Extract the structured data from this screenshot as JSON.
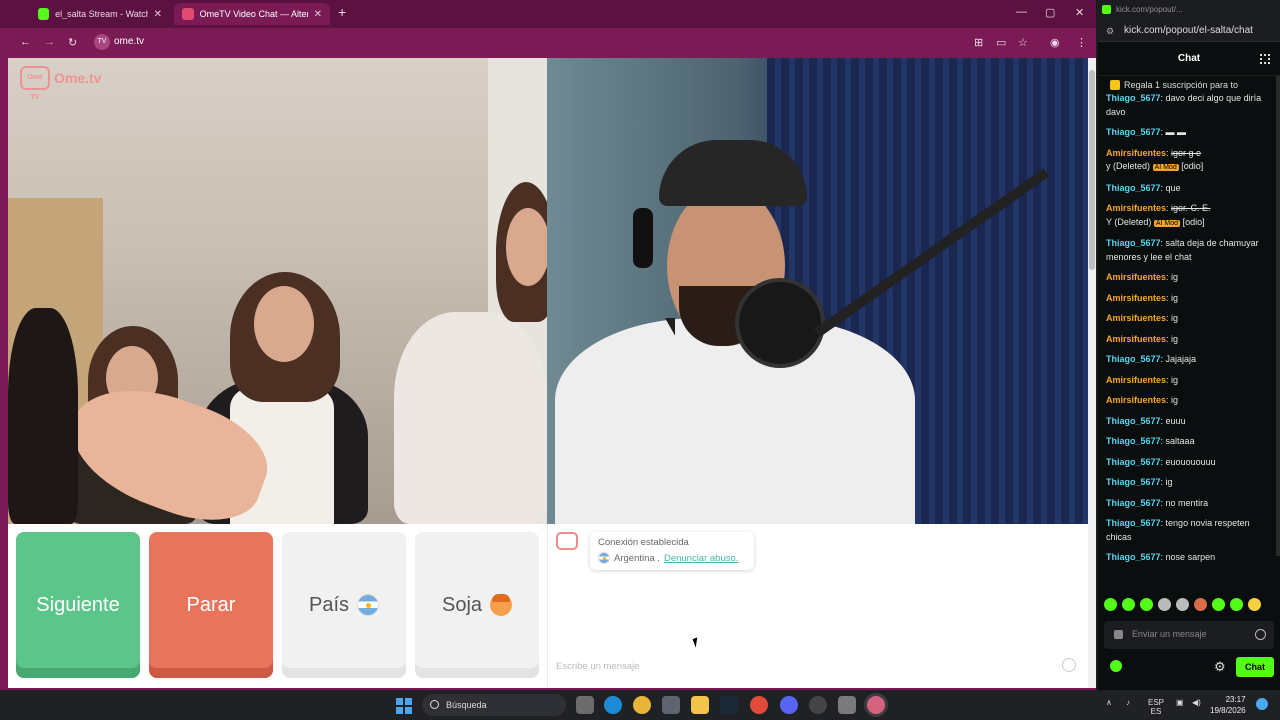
{
  "browser": {
    "tabs": [
      {
        "label": "el_salta Stream - Watch Live on Kick",
        "fav_color": "#53fc18"
      },
      {
        "label": "OmeTV Video Chat — Alternative",
        "fav_color": "#e24b6f"
      }
    ],
    "url": "ome.tv",
    "site_badge": "TV"
  },
  "ometv": {
    "logo_text_a": "Ome",
    "logo_text_b": ".tv",
    "logo_icon_text": "Ome TV",
    "buttons": {
      "next": "Siguiente",
      "stop": "Parar",
      "country": "País",
      "gender": "Soja"
    },
    "system_message": {
      "title": "Conexión establecida",
      "country": "Argentina .",
      "report": "Denunciar abuso."
    },
    "input_placeholder": "Escribe un mensaje"
  },
  "kick": {
    "window_url": "kick.com/popout/...",
    "address": "kick.com/popout/el-salta/chat",
    "header": "Chat",
    "pinned": "Regala 1 suscripción para to",
    "messages": [
      {
        "user": "Thiago_5677",
        "color": "cyan",
        "text": "davo deci algo que diría davo"
      },
      {
        "user": "Thiago_5677",
        "color": "cyan",
        "text": "▬ ▬"
      },
      {
        "user": "Amirsifuentes",
        "color": "orange",
        "text": "igor g e",
        "strike": true,
        "extra": "y (Deleted)",
        "badge": "AI Mod",
        "tail": "[odio]"
      },
      {
        "user": "Thiago_5677",
        "color": "cyan",
        "text": "que"
      },
      {
        "user": "Amirsifuentes",
        "color": "orange",
        "text": "igor. C. E.",
        "strike": true,
        "extra": "Y (Deleted)",
        "badge": "AI Mod",
        "tail": "[odio]"
      },
      {
        "user": "Thiago_5677",
        "color": "cyan",
        "text": "salta deja de chamuyar menores y lee el chat"
      },
      {
        "user": "Amirsifuentes",
        "color": "orange",
        "text": "ig"
      },
      {
        "user": "Amirsifuentes",
        "color": "orange",
        "text": "ig"
      },
      {
        "user": "Amirsifuentes",
        "color": "orange",
        "text": "ig"
      },
      {
        "user": "Amirsifuentes",
        "color": "orange",
        "text": "ig"
      },
      {
        "user": "Thiago_5677",
        "color": "cyan",
        "text": "Jajajaja"
      },
      {
        "user": "Amirsifuentes",
        "color": "orange",
        "text": "ig"
      },
      {
        "user": "Amirsifuentes",
        "color": "orange",
        "text": "ig"
      },
      {
        "user": "Thiago_5677",
        "color": "cyan",
        "text": "euuu"
      },
      {
        "user": "Thiago_5677",
        "color": "cyan",
        "text": "saltaaa"
      },
      {
        "user": "Thiago_5677",
        "color": "cyan",
        "text": "euouououuu"
      },
      {
        "user": "Thiago_5677",
        "color": "cyan",
        "text": "ig"
      },
      {
        "user": "Thiago_5677",
        "color": "cyan",
        "text": "no mentira"
      },
      {
        "user": "Thiago_5677",
        "color": "cyan",
        "text": "tengo novia respeten chicas"
      },
      {
        "user": "Thiago_5677",
        "color": "cyan",
        "text": "nose sarpen"
      }
    ],
    "input_placeholder": "Enviar un mensaje",
    "chat_button": "Chat"
  },
  "taskbar": {
    "search_label": "Búsqueda",
    "lang": "ESP",
    "lang_sub": "ES",
    "time": "23:17",
    "date": "19/8/2026"
  },
  "colors": {
    "browser_frame": "#7a1b55",
    "next_button": "#5cc58a",
    "stop_button": "#e8745c",
    "kick_green": "#53fc18"
  }
}
